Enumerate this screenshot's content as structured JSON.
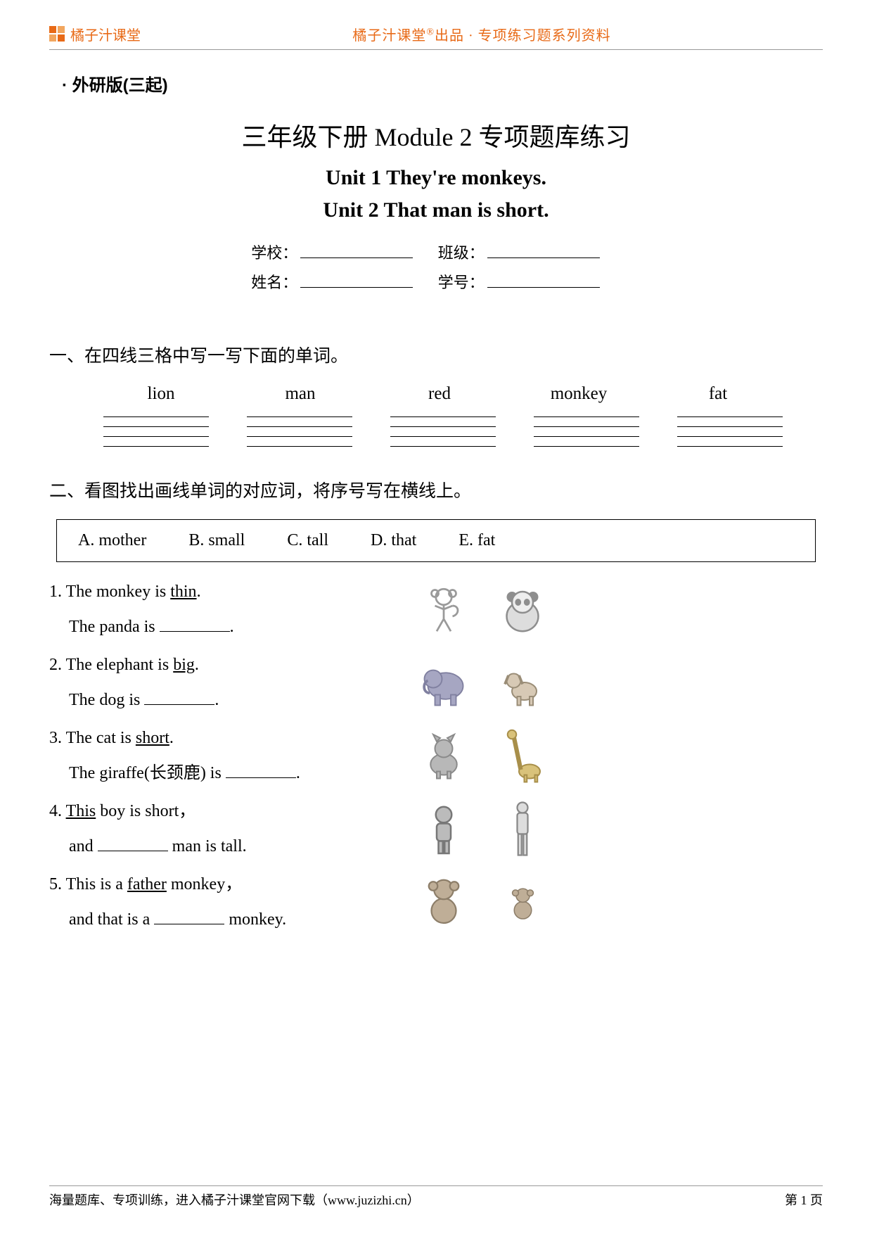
{
  "header": {
    "brand": "橘子汁课堂",
    "tagline_a": "橘子汁课堂",
    "tagline_sup": "®",
    "tagline_b": "出品 · 专项练习题系列资料"
  },
  "edition": "外研版(三起)",
  "titles": {
    "main_a": "三年级下册 ",
    "main_b": "Module 2 ",
    "main_c": "专项题库练习",
    "unit1": "Unit 1 They're monkeys.",
    "unit2": "Unit 2 That man is short."
  },
  "info": {
    "school": "学校：",
    "class": "班级：",
    "name": "姓名：",
    "id": "学号："
  },
  "section1": {
    "heading": "一、在四线三格中写一写下面的单词。",
    "words": [
      "lion",
      "man",
      "red",
      "monkey",
      "fat"
    ]
  },
  "section2": {
    "heading": "二、看图找出画线单词的对应词，将序号写在横线上。",
    "options": [
      "A. mother",
      "B. small",
      "C. tall",
      "D. that",
      "E. fat"
    ],
    "items": [
      {
        "num": "1.",
        "l1a": "The monkey is ",
        "l1u": "thin",
        "l1b": ".",
        "l2a": "The panda is ",
        "l2b": ".",
        "pic1": "monkey",
        "pic2": "panda"
      },
      {
        "num": "2.",
        "l1a": "The elephant is ",
        "l1u": "big",
        "l1b": ".",
        "l2a": "The dog is ",
        "l2b": ".",
        "pic1": "elephant",
        "pic2": "dog"
      },
      {
        "num": "3.",
        "l1a": "The cat is ",
        "l1u": "short",
        "l1b": ".",
        "l2a": "The giraffe(长颈鹿) is ",
        "l2b": ".",
        "pic1": "cat",
        "pic2": "giraffe"
      },
      {
        "num": "4.",
        "l1u": "This",
        "l1b": " boy is short，",
        "l2a": "and ",
        "l2b": " man is tall.",
        "pic1": "boy",
        "pic2": "man"
      },
      {
        "num": "5.",
        "l1a": "This is a ",
        "l1u": "father",
        "l1b": " monkey，",
        "l2a": "and that is a ",
        "l2b": " monkey.",
        "pic1": "monkey-big",
        "pic2": "monkey-small"
      }
    ]
  },
  "footer": {
    "left": "海量题库、专项训练，进入橘子汁课堂官网下载（www.juzizhi.cn）",
    "right": "第 1 页"
  }
}
